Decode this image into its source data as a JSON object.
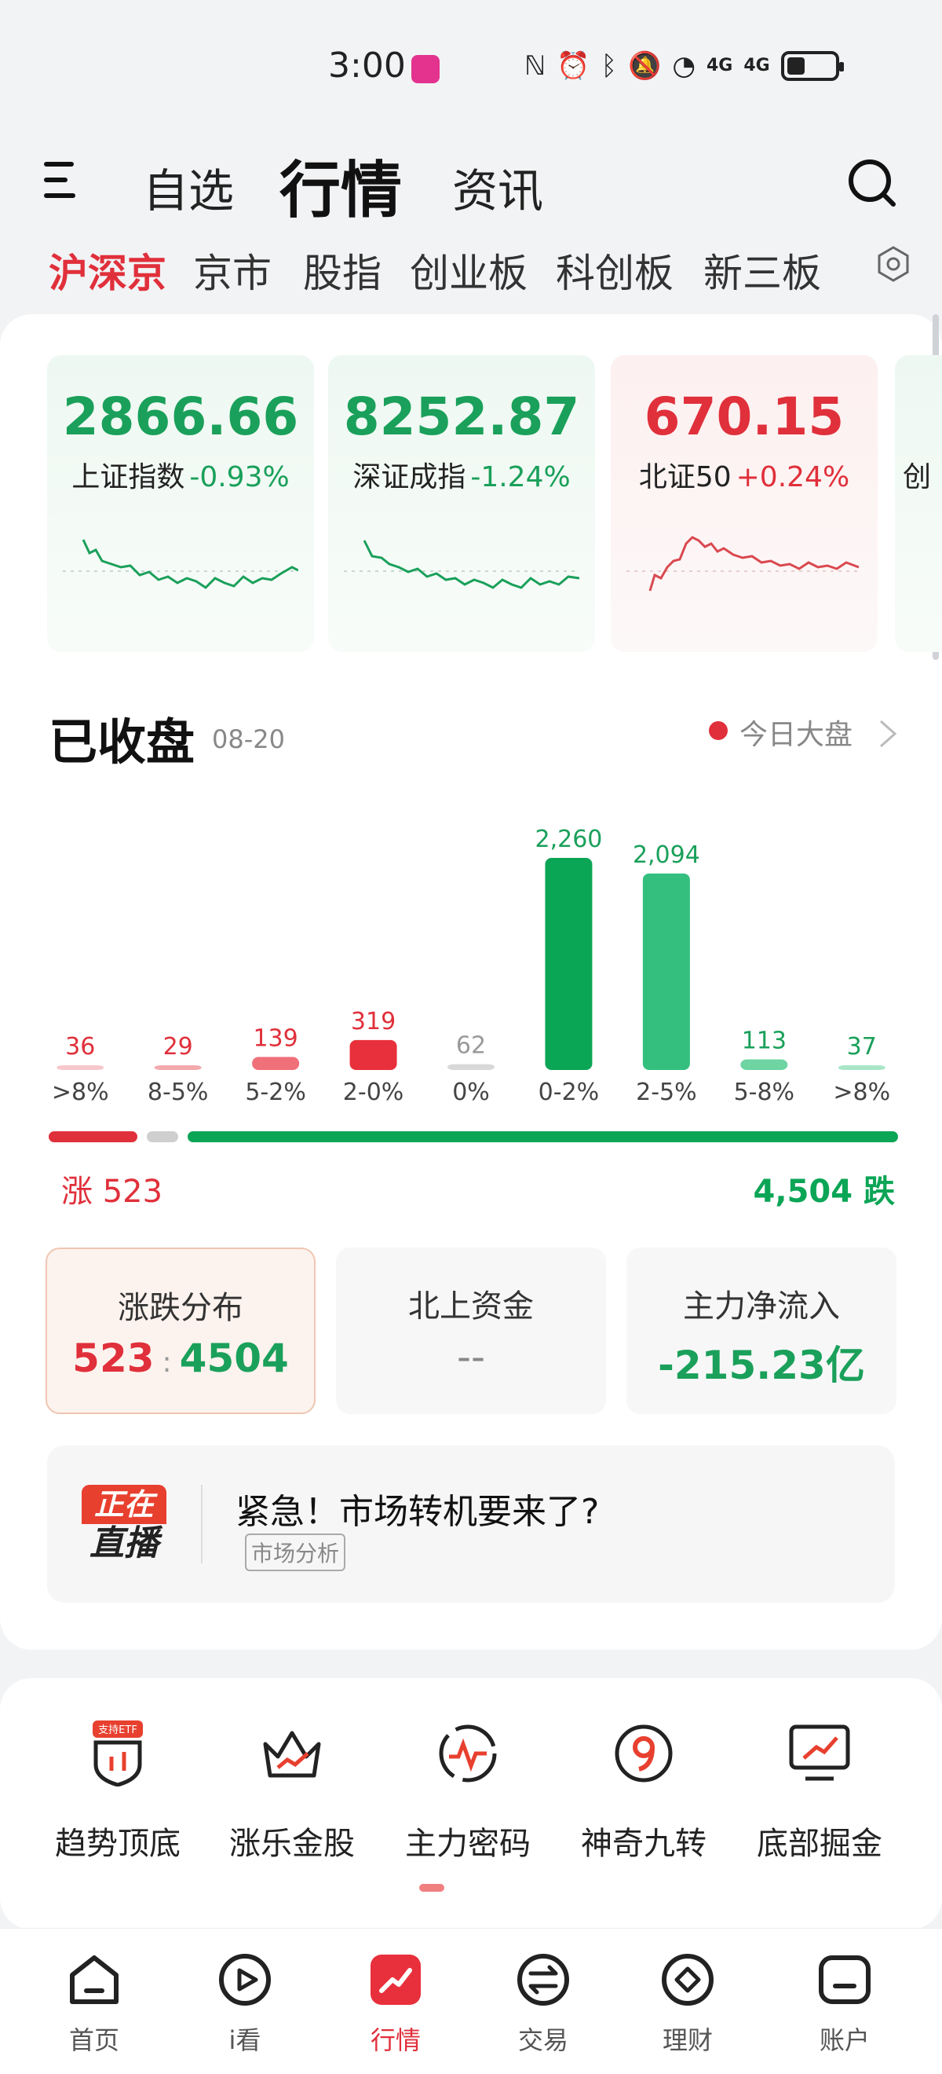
{
  "status_bar": {
    "time": "3:00",
    "signal_labels": [
      "4G",
      "4G"
    ]
  },
  "top_nav": {
    "tabs": [
      "自选",
      "行情",
      "资讯"
    ],
    "active_tab": "行情"
  },
  "sub_tabs": {
    "items": [
      "沪深京",
      "京市",
      "股指",
      "创业板",
      "科创板",
      "新三板"
    ],
    "active": "沪深京"
  },
  "index_cards": [
    {
      "value": "2866.66",
      "name": "上证指数",
      "change": "-0.93%",
      "trend": "down"
    },
    {
      "value": "8252.87",
      "name": "深证成指",
      "change": "-1.24%",
      "trend": "down"
    },
    {
      "value": "670.15",
      "name": "北证50",
      "change": "+0.24%",
      "trend": "up"
    },
    {
      "value": "",
      "name": "创",
      "change": "",
      "trend": "down"
    }
  ],
  "market_status": {
    "title": "已收盘",
    "date": "08-20",
    "today_link": "今日大盘"
  },
  "chart_data": {
    "type": "bar",
    "categories": [
      ">8%",
      "8-5%",
      "5-2%",
      "2-0%",
      "0%",
      "0-2%",
      "2-5%",
      "5-8%",
      ">8%"
    ],
    "values": [
      36,
      29,
      139,
      319,
      62,
      2260,
      2094,
      113,
      37
    ],
    "value_labels": [
      "36",
      "29",
      "139",
      "319",
      "62",
      "2,260",
      "2,094",
      "113",
      "37"
    ],
    "bar_colors": [
      "#f7c8cb",
      "#f4a9ad",
      "#f0707a",
      "#e8303c",
      "#d8d8d8",
      "#0ba556",
      "#34bf7f",
      "#6dd4a2",
      "#a9e6c7"
    ],
    "label_colors": [
      "#e0303b",
      "#e0303b",
      "#e0303b",
      "#e0303b",
      "#999999",
      "#1aa05a",
      "#1aa05a",
      "#1aa05a",
      "#1aa05a"
    ],
    "ylim": [
      0,
      2260
    ]
  },
  "rise_fall": {
    "rise_label": "涨 523",
    "fall_label": "4,504 跌",
    "rise": 523,
    "fall": 4504
  },
  "stats": [
    {
      "label": "涨跌分布",
      "value_rise": "523",
      "sep": ":",
      "value_fall": "4504"
    },
    {
      "label": "北上资金",
      "value": "--"
    },
    {
      "label": "主力净流入",
      "value": "-215.23亿"
    }
  ],
  "live_banner": {
    "badge_top": "正在",
    "badge_bottom": "直播",
    "title": "紧急！市场转机要来了?",
    "tag": "市场分析"
  },
  "tools": [
    {
      "label": "趋势顶底",
      "icon": "shield-chart-icon",
      "badge": "支持ETF"
    },
    {
      "label": "涨乐金股",
      "icon": "crown-chart-icon"
    },
    {
      "label": "主力密码",
      "icon": "pulse-circle-icon"
    },
    {
      "label": "神奇九转",
      "icon": "nine-circle-icon"
    },
    {
      "label": "底部掘金",
      "icon": "monitor-chart-icon"
    }
  ],
  "bottom_nav": [
    {
      "label": "首页",
      "icon": "home-icon"
    },
    {
      "label": "i看",
      "icon": "play-icon"
    },
    {
      "label": "行情",
      "icon": "market-icon"
    },
    {
      "label": "交易",
      "icon": "exchange-icon"
    },
    {
      "label": "理财",
      "icon": "wealth-icon"
    },
    {
      "label": "账户",
      "icon": "account-icon"
    }
  ],
  "colors": {
    "red": "#e0303b",
    "green": "#0ba556",
    "accent": "#e0303b"
  }
}
